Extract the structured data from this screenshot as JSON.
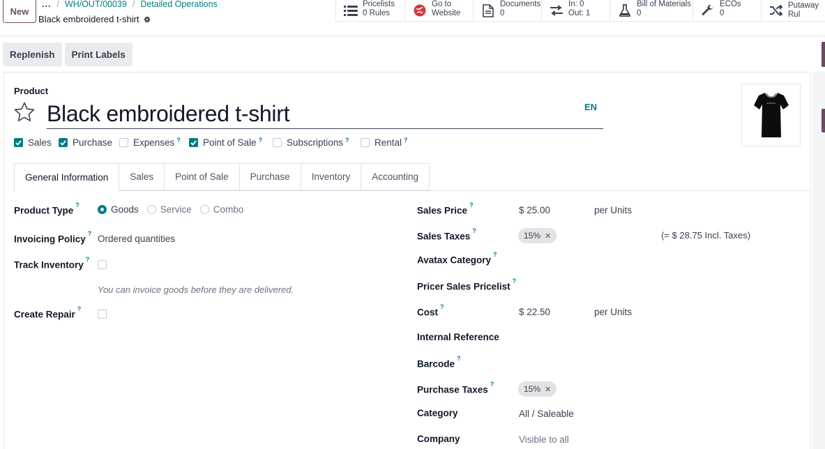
{
  "control_panel": {
    "new_label": "New",
    "breadcrumb": {
      "more": "...",
      "ref": "WH/OUT/00039",
      "current": "Detailed Operations"
    },
    "record_title": "Black embroidered t-shirt",
    "smart_buttons": [
      {
        "icon": "list-icon",
        "line1": "Pricelists",
        "line2": "0 Rules"
      },
      {
        "icon": "globe-icon",
        "line1": "Go to",
        "line2": "Website"
      },
      {
        "icon": "document-icon",
        "line1": "Documents",
        "line2": "0"
      },
      {
        "icon": "transfer-arrows-icon",
        "line1": "In: 0",
        "line2": "Out: 1"
      },
      {
        "icon": "flask-icon",
        "line1": "Bill of Materials",
        "line2": "0"
      },
      {
        "icon": "wrench-icon",
        "line1": "ECOs",
        "line2": "0"
      },
      {
        "icon": "shuffle-icon",
        "line1": "Putaway Rul",
        "line2": ""
      }
    ]
  },
  "actions": {
    "replenish": "Replenish",
    "print_labels": "Print Labels"
  },
  "product": {
    "label": "Product",
    "name": "Black embroidered t-shirt",
    "lang": "EN",
    "flags": [
      {
        "label": "Sales",
        "checked": true,
        "help": false
      },
      {
        "label": "Purchase",
        "checked": true,
        "help": false
      },
      {
        "label": "Expenses",
        "checked": false,
        "help": true
      },
      {
        "label": "Point of Sale",
        "checked": true,
        "help": true
      },
      {
        "label": "Subscriptions",
        "checked": false,
        "help": true
      },
      {
        "label": "Rental",
        "checked": false,
        "help": true
      }
    ]
  },
  "tabs": [
    "General Information",
    "Sales",
    "Point of Sale",
    "Purchase",
    "Inventory",
    "Accounting"
  ],
  "left_fields": {
    "product_type": {
      "label": "Product Type",
      "options": [
        "Goods",
        "Service",
        "Combo"
      ],
      "selected": "Goods"
    },
    "invoicing_policy": {
      "label": "Invoicing Policy",
      "value": "Ordered quantities"
    },
    "track_inventory": {
      "label": "Track Inventory",
      "checked": false
    },
    "hint": "You can invoice goods before they are delivered.",
    "create_repair": {
      "label": "Create Repair",
      "checked": false
    }
  },
  "right_fields": {
    "sales_price": {
      "label": "Sales Price",
      "value": "$ 25.00",
      "unit": "per Units"
    },
    "sales_taxes": {
      "label": "Sales Taxes",
      "tag": "15%",
      "incl": "(= $ 28.75 Incl. Taxes)"
    },
    "avatax_category": {
      "label": "Avatax Category"
    },
    "pricer_sales_pricelist": {
      "label": "Pricer Sales Pricelist"
    },
    "cost": {
      "label": "Cost",
      "value": "$ 22.50",
      "unit": "per Units"
    },
    "internal_reference": {
      "label": "Internal Reference"
    },
    "barcode": {
      "label": "Barcode"
    },
    "purchase_taxes": {
      "label": "Purchase Taxes",
      "tag": "15%"
    },
    "category": {
      "label": "Category",
      "value": "All / Saleable"
    },
    "company": {
      "label": "Company",
      "placeholder": "Visible to all"
    }
  },
  "colors": {
    "accent": "#017e84",
    "brand": "#714b67",
    "tag_bg": "#e5e1e4"
  }
}
